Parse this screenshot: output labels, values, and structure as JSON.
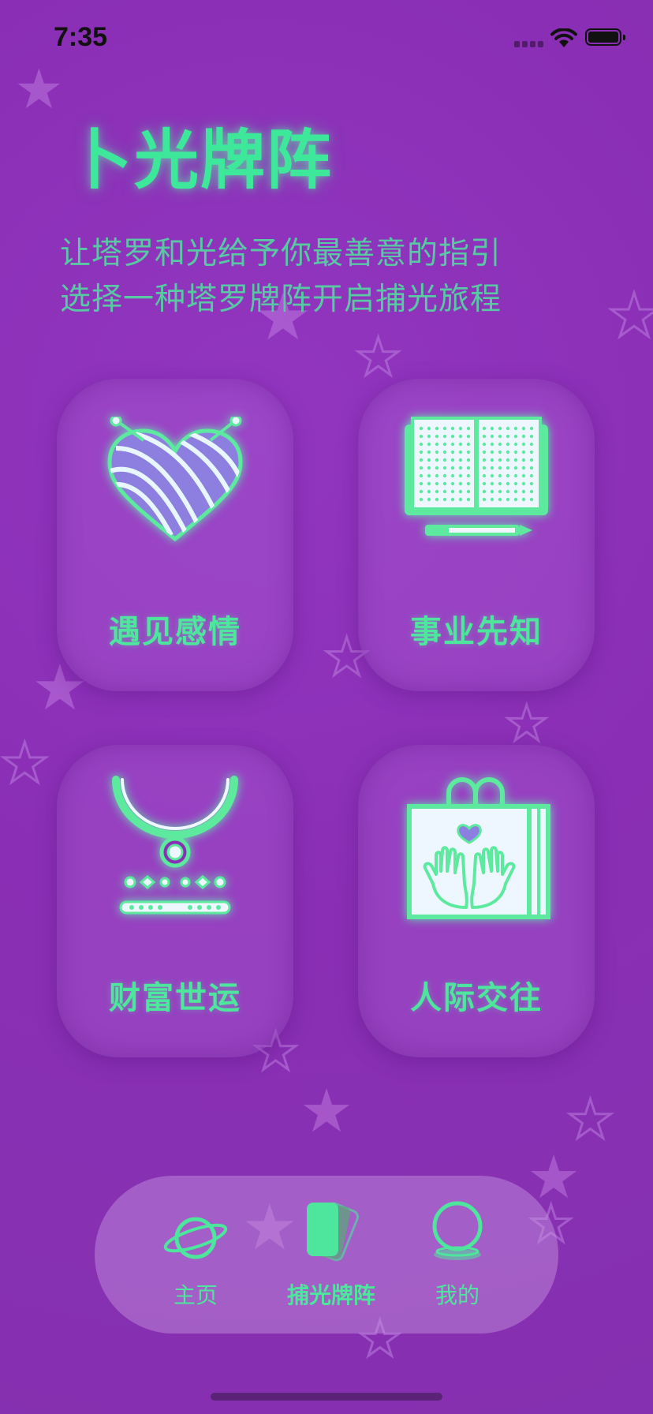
{
  "status_bar": {
    "time": "7:35"
  },
  "header": {
    "title": "卜光牌阵",
    "subtitle_line1": "让塔罗和光给予你最善意的指引",
    "subtitle_line2": "选择一种塔罗牌阵开启捕光旅程"
  },
  "cards": [
    {
      "label": "遇见感情",
      "icon": "heart-yarn-icon"
    },
    {
      "label": "事业先知",
      "icon": "open-book-icon"
    },
    {
      "label": "财富世运",
      "icon": "necklace-icon"
    },
    {
      "label": "人际交往",
      "icon": "gift-bag-hands-icon"
    }
  ],
  "tab_bar": {
    "tabs": [
      {
        "label": "主页",
        "icon": "planet-icon",
        "active": false
      },
      {
        "label": "捕光牌阵",
        "icon": "cards-icon",
        "active": true
      },
      {
        "label": "我的",
        "icon": "crystal-ball-icon",
        "active": false
      }
    ]
  },
  "colors": {
    "background": "#8a2fb5",
    "accent": "#3ee89a",
    "subtitle": "#58c9a3"
  }
}
